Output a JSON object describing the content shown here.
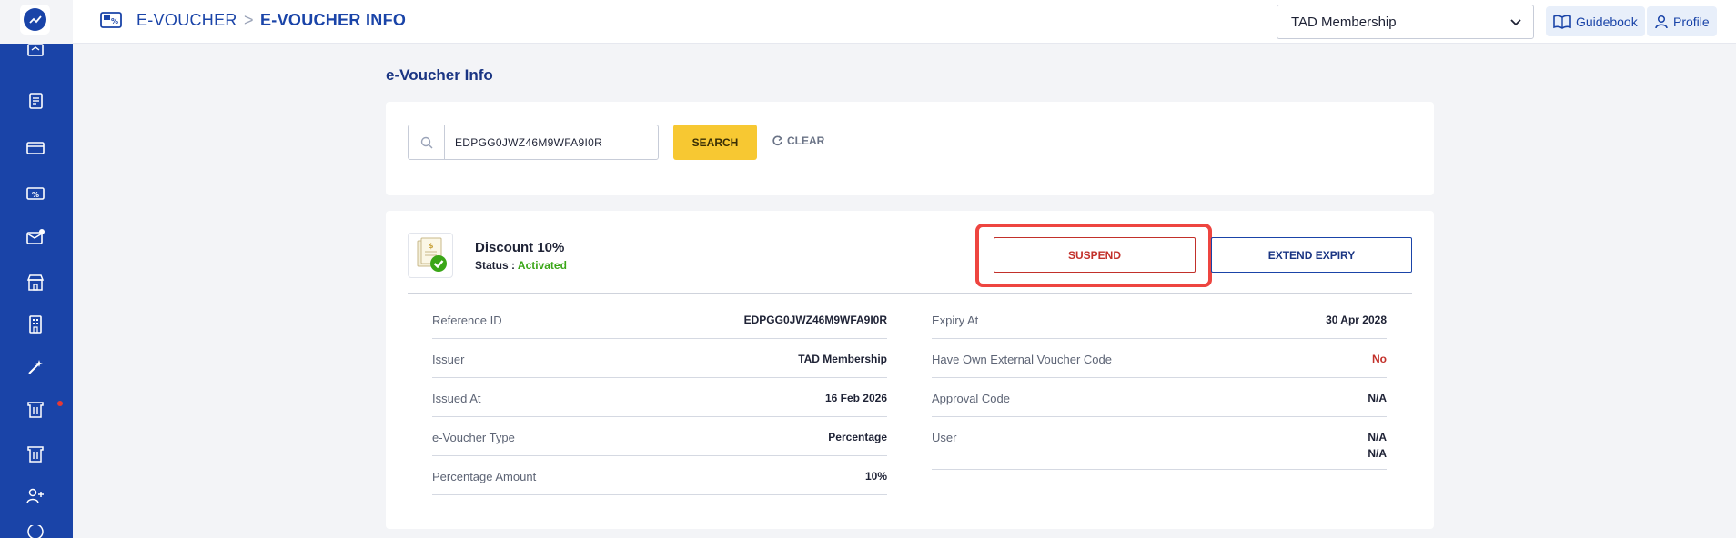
{
  "sidebar": {
    "logo": "analytics-logo-icon",
    "items": [
      {
        "icon": "dashboard-icon"
      },
      {
        "icon": "document-list-icon"
      },
      {
        "icon": "card-icon"
      },
      {
        "icon": "voucher-icon"
      },
      {
        "icon": "mail-notification-icon"
      },
      {
        "icon": "store-icon"
      },
      {
        "icon": "building-icon"
      },
      {
        "icon": "magic-wand-icon"
      },
      {
        "icon": "ticket-icon"
      },
      {
        "icon": "ticket-alt-icon"
      },
      {
        "icon": "user-add-icon"
      },
      {
        "icon": "more-icon"
      }
    ]
  },
  "header": {
    "breadcrumb_root": "E-VOUCHER",
    "breadcrumb_separator": ">",
    "breadcrumb_current": "E-VOUCHER INFO",
    "membership_select": "TAD Membership",
    "guidebook_label": "Guidebook",
    "profile_label": "Profile"
  },
  "page": {
    "title": "e-Voucher Info"
  },
  "search": {
    "value": "EDPGG0JWZ46M9WFA9I0R",
    "search_label": "SEARCH",
    "clear_label": "CLEAR"
  },
  "voucher": {
    "name": "Discount 10%",
    "status_label": "Status :",
    "status_value": "Activated",
    "suspend_label": "SUSPEND",
    "extend_label": "EXTEND EXPIRY",
    "left_details": [
      {
        "label": "Reference ID",
        "value": "EDPGG0JWZ46M9WFA9I0R"
      },
      {
        "label": "Issuer",
        "value": "TAD Membership"
      },
      {
        "label": "Issued At",
        "value": "16 Feb 2026"
      },
      {
        "label": "e-Voucher Type",
        "value": "Percentage"
      },
      {
        "label": "Percentage Amount",
        "value": "10%"
      }
    ],
    "right_details": [
      {
        "label": "Expiry At",
        "value": "30 Apr 2028"
      },
      {
        "label": "Have Own External Voucher Code",
        "value": "No"
      },
      {
        "label": "Approval Code",
        "value": "N/A"
      },
      {
        "label": "User",
        "value": "N/A",
        "value2": "N/A"
      }
    ]
  },
  "colors": {
    "primary": "#1a44a8",
    "accent_yellow": "#f7c832",
    "danger": "#c2302a",
    "success": "#3aa617",
    "highlight": "#ee4540"
  }
}
